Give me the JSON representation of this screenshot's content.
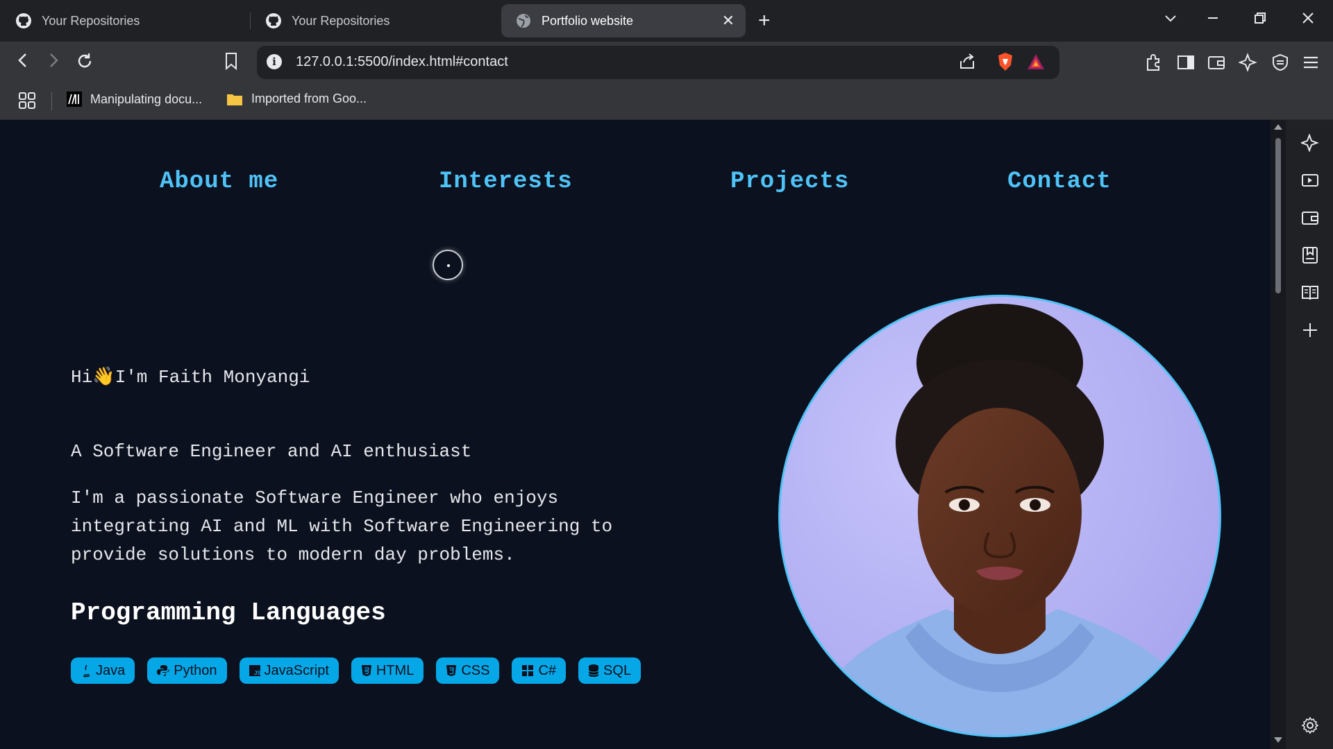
{
  "browser": {
    "tabs": [
      {
        "title": "Your Repositories",
        "icon": "github-icon"
      },
      {
        "title": "Your Repositories",
        "icon": "github-icon"
      },
      {
        "title": "Portfolio website",
        "icon": "globe-icon",
        "active": true
      }
    ],
    "url": "127.0.0.1:5500/index.html#contact",
    "bookmarks": [
      {
        "label": "Manipulating docu...",
        "icon": "mdn-icon"
      },
      {
        "label": "Imported from Goo...",
        "icon": "folder-icon"
      }
    ]
  },
  "nav": {
    "about": "About me",
    "interests": "Interests",
    "projects": "Projects",
    "contact": "Contact"
  },
  "hero": {
    "greeting_prefix": "Hi",
    "greeting_emoji": "👋",
    "greeting_name": "I'm Faith Monyangi",
    "tagline": "A Software Engineer and AI enthusiast",
    "bio_lines": [
      "I'm a passionate Software Engineer who enjoys",
      "integrating AI and ML with Software Engineering to",
      "provide solutions to modern day problems."
    ]
  },
  "skills": {
    "title": "Programming Languages",
    "items": [
      {
        "label": "Java",
        "icon": "java-icon"
      },
      {
        "label": "Python",
        "icon": "python-icon"
      },
      {
        "label": "JavaScript",
        "icon": "javascript-icon"
      },
      {
        "label": "HTML",
        "icon": "html5-icon"
      },
      {
        "label": "CSS",
        "icon": "css3-icon"
      },
      {
        "label": "C#",
        "icon": "windows-icon"
      },
      {
        "label": "SQL",
        "icon": "database-icon"
      }
    ]
  },
  "colors": {
    "page_bg": "#0c111f",
    "accent": "#4fc3f7",
    "chip_bg": "#06a7e7"
  }
}
